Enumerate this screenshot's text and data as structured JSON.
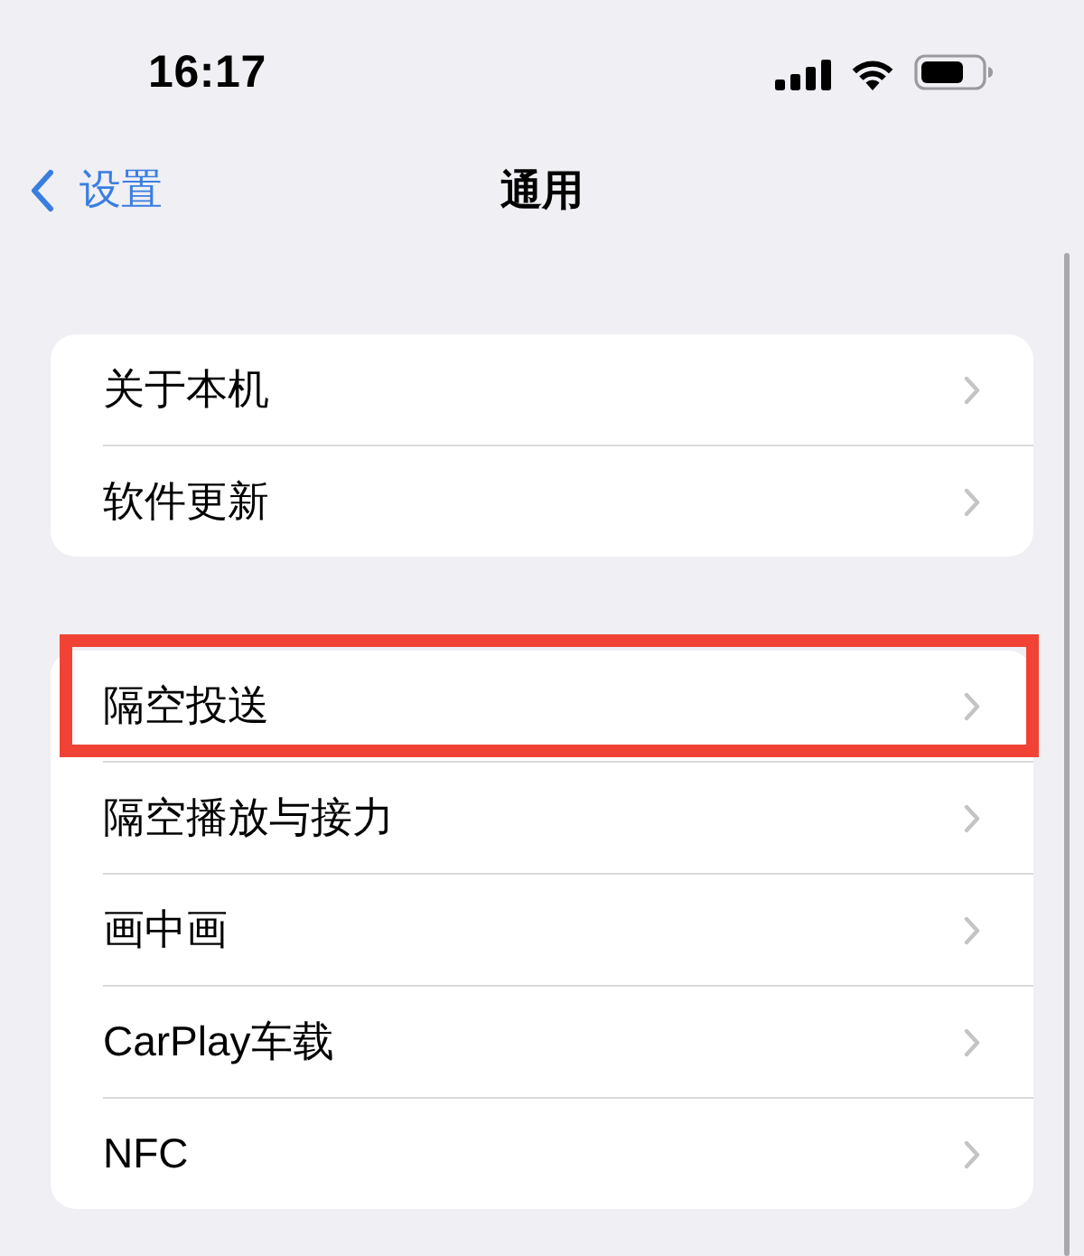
{
  "status_bar": {
    "time": "16:17"
  },
  "nav_bar": {
    "back_label": "设置",
    "title": "通用"
  },
  "groups": [
    {
      "items": [
        {
          "label": "关于本机",
          "highlighted": false
        },
        {
          "label": "软件更新",
          "highlighted": false
        }
      ]
    },
    {
      "items": [
        {
          "label": "隔空投送",
          "highlighted": true
        },
        {
          "label": "隔空播放与接力",
          "highlighted": false
        },
        {
          "label": "画中画",
          "highlighted": false
        },
        {
          "label": "CarPlay车载",
          "highlighted": false
        },
        {
          "label": "NFC",
          "highlighted": false
        }
      ]
    }
  ]
}
